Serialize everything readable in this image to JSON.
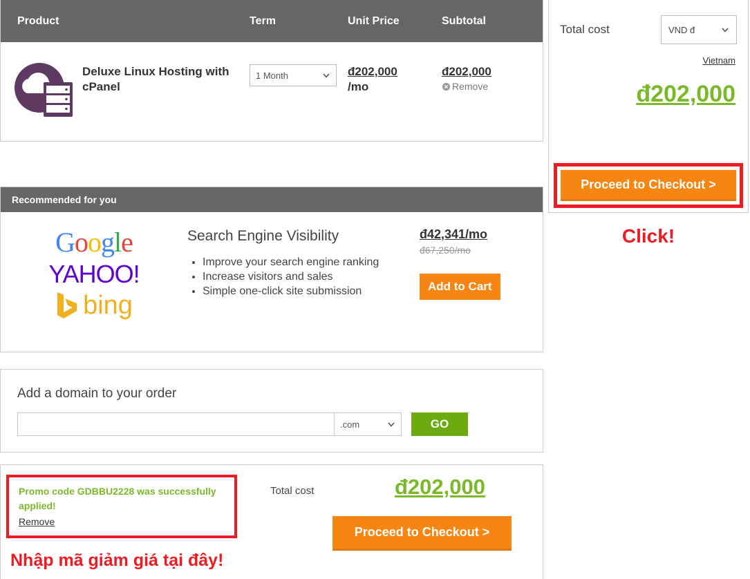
{
  "cart": {
    "columns": {
      "product": "Product",
      "term": "Term",
      "unit_price": "Unit Price",
      "subtotal": "Subtotal"
    },
    "items": [
      {
        "icon": "cloud-server-icon",
        "title": "Deluxe Linux Hosting with cPanel",
        "term_selected": "1 Month",
        "unit_price": "đ202,000",
        "unit_price_suffix": "/mo",
        "subtotal": "đ202,000",
        "remove_label": "Remove"
      }
    ]
  },
  "recommended": {
    "header": "Recommended for you",
    "logos": [
      "google-logo",
      "yahoo-logo",
      "bing-logo"
    ],
    "google_letters": [
      "G",
      "o",
      "o",
      "g",
      "l",
      "e"
    ],
    "yahoo_text": "YAHOO!",
    "bing_text": "bing",
    "title": "Search Engine Visibility",
    "bullets": [
      "Improve your search engine ranking",
      "Increase visitors and sales",
      "Simple one-click site submission"
    ],
    "price": "đ42,341/mo",
    "price_was": "đ67,250/mo",
    "add_to_cart_label": "Add to Cart"
  },
  "domain": {
    "title": "Add a domain to your order",
    "input_value": "",
    "input_placeholder": "",
    "tld_selected": ".com",
    "go_label": "GO"
  },
  "promo": {
    "message": "Promo code GDBBU2228 was successfully applied!",
    "code": "GDBBU2228",
    "remove_label": "Remove",
    "annotation": "Nhập mã giảm giá tại đây!",
    "total_label": "Total cost",
    "total_value": "đ202,000",
    "checkout_label": "Proceed to Checkout >"
  },
  "summary": {
    "total_label": "Total cost",
    "currency_selected": "VND đ",
    "country_link": "Vietnam",
    "total_value": "đ202,000",
    "checkout_label": "Proceed to Checkout >",
    "click_annotation": "Click!"
  },
  "colors": {
    "header_gray": "#666666",
    "orange": "#f68511",
    "green": "#7AB929",
    "green_go": "#6cab10",
    "red_highlight": "#ED1C24",
    "purple_icon": "#5E3A63"
  }
}
